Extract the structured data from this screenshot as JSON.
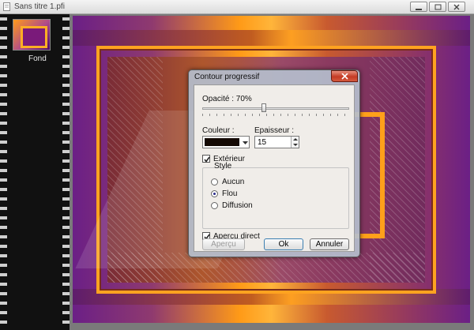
{
  "window": {
    "title": "Sans titre 1.pfi"
  },
  "layers": {
    "items": [
      {
        "label": "Fond"
      }
    ]
  },
  "dialog": {
    "title": "Contour progressif",
    "opacity_label": "Opacité : 70%",
    "opacity_value": 70,
    "color_label": "Couleur :",
    "color_value": "#140904",
    "thickness_label": "Epaisseur :",
    "thickness_value": "15",
    "exterior_label": "Extérieur",
    "exterior_checked": true,
    "style_label": "Style",
    "style_options": [
      {
        "label": "Aucun",
        "selected": false
      },
      {
        "label": "Flou",
        "selected": true
      },
      {
        "label": "Diffusion",
        "selected": false
      }
    ],
    "preview_label": "Aperçu direct",
    "preview_checked": true,
    "buttons": {
      "apercu": "Aperçu",
      "ok": "Ok",
      "cancel": "Annuler"
    }
  },
  "colors": {
    "accent_orange": "#ffa320",
    "purple": "#6b1f86",
    "dialog_close": "#c43a24"
  }
}
